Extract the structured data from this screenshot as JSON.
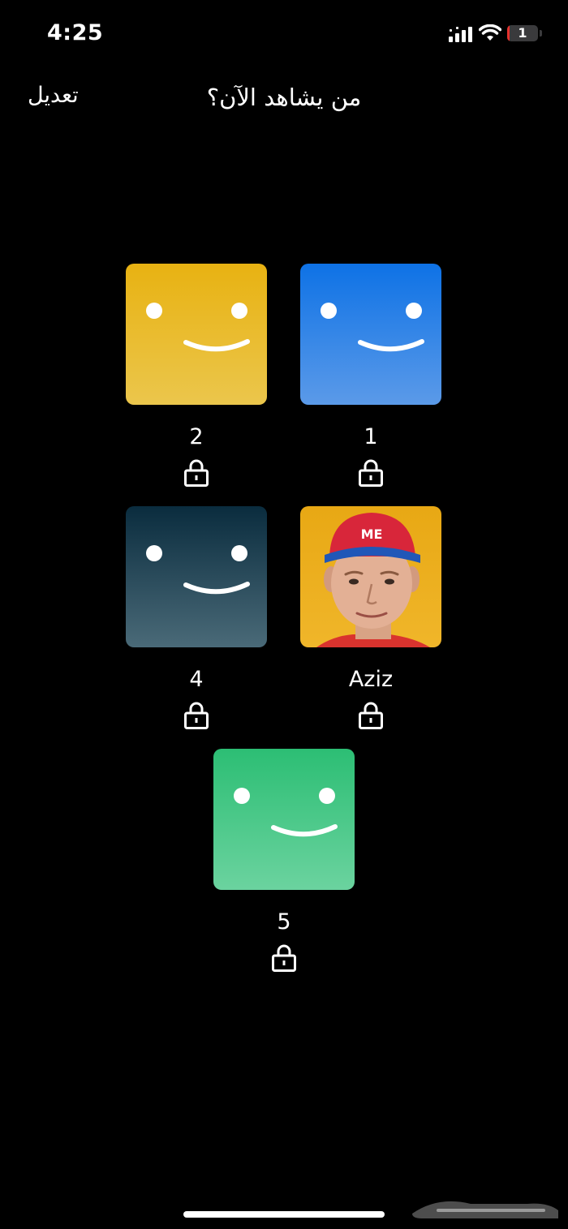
{
  "status_bar": {
    "time": "4:25",
    "battery_level": "1",
    "battery_fraction": 0.08,
    "icons": [
      "signal-icon",
      "wifi-icon",
      "battery-icon"
    ]
  },
  "nav": {
    "edit_label": "تعديل",
    "title": "من يشاهد الآن؟"
  },
  "profiles": [
    {
      "name": "1",
      "avatar": "smiley-blue",
      "locked": true
    },
    {
      "name": "2",
      "avatar": "smiley-yellow",
      "locked": true
    },
    {
      "name": "Aziz",
      "avatar": "photo-red-cap-man",
      "locked": true
    },
    {
      "name": "4",
      "avatar": "smiley-dark-teal",
      "locked": true
    },
    {
      "name": "5",
      "avatar": "smiley-green",
      "locked": true
    }
  ],
  "colors": {
    "background": "#000000",
    "blue": "#0e72e6",
    "yellow": "#e8b212",
    "dark_teal": "#0a2c3e",
    "green": "#2cbe74",
    "battery_red": "#e5312d"
  }
}
